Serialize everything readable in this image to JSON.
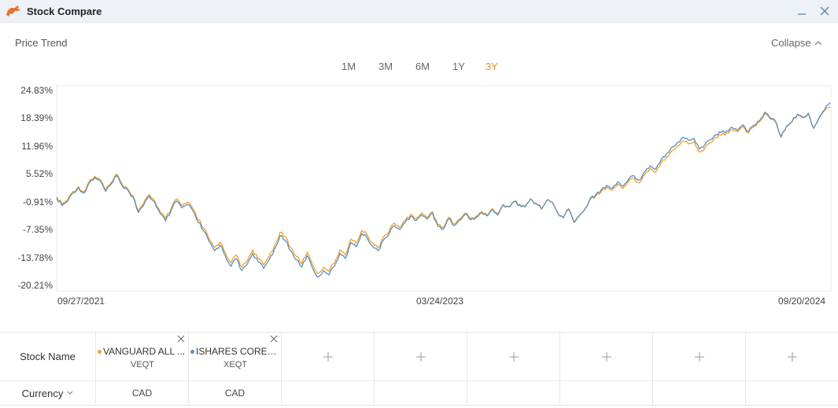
{
  "window": {
    "title": "Stock Compare",
    "brand_color": "#e8732e"
  },
  "panel": {
    "title": "Price Trend",
    "collapse_label": "Collapse"
  },
  "range_tabs": {
    "items": [
      "1M",
      "3M",
      "6M",
      "1Y",
      "3Y"
    ],
    "active": "3Y",
    "active_color": "#e8912e"
  },
  "chart_data": {
    "type": "line",
    "x_start": "09/27/2021",
    "x_end": "09/20/2024",
    "x_tick_labels": [
      "09/27/2021",
      "03/24/2023",
      "09/20/2024"
    ],
    "y_tick_labels": [
      "24.83%",
      "18.39%",
      "11.96%",
      "5.52%",
      "-0.91%",
      "-7.35%",
      "-13.78%",
      "-20.21%"
    ],
    "y_ticks": [
      24.83,
      18.39,
      11.96,
      5.52,
      -0.91,
      -7.35,
      -13.78,
      -20.21
    ],
    "ylim": [
      -20.21,
      24.83
    ],
    "grid": false,
    "series": [
      {
        "ticker": "VEQT",
        "color": "#f2a12c",
        "values": [
          0.2,
          -1.5,
          -0.5,
          1.5,
          2.6,
          1.4,
          3.8,
          5.0,
          4.2,
          1.8,
          3.5,
          5.5,
          3.2,
          2.2,
          0.5,
          -3.0,
          -1.2,
          0.8,
          -0.6,
          -3.2,
          -4.8,
          -2.5,
          -0.2,
          -1.8,
          -1.0,
          -2.5,
          -5.0,
          -7.0,
          -9.5,
          -11.5,
          -10.2,
          -12.8,
          -15.0,
          -13.2,
          -16.0,
          -14.5,
          -12.0,
          -14.0,
          -15.5,
          -13.5,
          -11.0,
          -8.0,
          -9.0,
          -11.5,
          -13.5,
          -15.2,
          -12.5,
          -15.5,
          -17.5,
          -16.0,
          -17.0,
          -15.0,
          -12.0,
          -13.2,
          -9.5,
          -10.5,
          -7.5,
          -8.5,
          -10.5,
          -11.5,
          -9.0,
          -7.8,
          -5.8,
          -6.8,
          -5.2,
          -3.8,
          -4.8,
          -3.5,
          -4.5,
          -3.2,
          -6.2,
          -6.8,
          -4.5,
          -6.0,
          -4.8,
          -3.5,
          -4.8,
          -4.2,
          -3.2,
          -4.0,
          -2.5,
          -3.8,
          -1.5,
          -2.0,
          -0.8,
          -1.5,
          -2.0,
          -0.2,
          -1.2,
          -2.5,
          -0.5,
          -1.0,
          -3.5,
          -4.5,
          -2.5,
          -5.5,
          -4.0,
          -2.5,
          -0.2,
          0.5,
          1.5,
          2.5,
          1.8,
          3.2,
          2.2,
          3.8,
          4.5,
          3.5,
          5.5,
          6.8,
          6.0,
          8.2,
          9.5,
          11.0,
          12.0,
          13.2,
          12.5,
          13.0,
          10.5,
          11.5,
          12.8,
          14.0,
          14.5,
          15.0,
          15.8,
          15.2,
          16.5,
          15.0,
          16.5,
          17.5,
          19.5,
          18.2,
          17.5,
          14.0,
          16.5,
          17.5,
          19.2,
          18.5,
          19.5,
          16.0,
          18.5,
          20.2,
          21.0
        ]
      },
      {
        "ticker": "XEQT",
        "color": "#5b8fbe",
        "values": [
          0.0,
          -1.8,
          -0.8,
          1.2,
          2.4,
          1.1,
          3.5,
          4.7,
          3.9,
          1.5,
          3.2,
          5.2,
          2.9,
          1.9,
          0.2,
          -3.4,
          -1.6,
          0.4,
          -1.0,
          -3.6,
          -5.3,
          -3.0,
          -0.7,
          -2.3,
          -1.5,
          -3.0,
          -5.6,
          -7.6,
          -10.1,
          -12.2,
          -10.9,
          -13.5,
          -15.8,
          -14.0,
          -16.8,
          -15.3,
          -12.8,
          -14.8,
          -16.3,
          -14.3,
          -11.8,
          -8.8,
          -9.8,
          -12.3,
          -14.3,
          -16.0,
          -13.3,
          -16.3,
          -18.3,
          -16.8,
          -17.8,
          -15.8,
          -12.8,
          -14.0,
          -10.3,
          -11.3,
          -8.2,
          -9.2,
          -11.2,
          -12.2,
          -9.7,
          -8.4,
          -6.4,
          -7.3,
          -5.7,
          -4.2,
          -5.2,
          -3.9,
          -4.9,
          -3.5,
          -6.6,
          -7.2,
          -4.8,
          -6.4,
          -5.1,
          -3.8,
          -5.1,
          -4.5,
          -3.4,
          -4.2,
          -2.7,
          -4.0,
          -1.6,
          -2.1,
          -0.9,
          -1.6,
          -2.1,
          -0.2,
          -1.3,
          -2.6,
          -0.5,
          -1.0,
          -3.6,
          -4.6,
          -2.6,
          -5.7,
          -4.1,
          -2.5,
          0.0,
          0.8,
          1.9,
          2.9,
          2.2,
          3.7,
          2.7,
          4.3,
          5.1,
          4.1,
          6.1,
          7.4,
          6.7,
          8.9,
          10.3,
          11.8,
          12.8,
          14.0,
          13.3,
          13.8,
          11.3,
          12.3,
          13.5,
          14.6,
          15.1,
          15.5,
          16.3,
          15.6,
          16.9,
          15.3,
          16.8,
          17.8,
          19.8,
          18.4,
          17.7,
          14.1,
          16.6,
          17.6,
          19.3,
          18.6,
          19.6,
          16.1,
          18.6,
          20.4,
          22.0
        ]
      }
    ]
  },
  "compare_table": {
    "stock_header": "Stock Name",
    "currency_header": "Currency",
    "stocks": [
      {
        "name": "VANGUARD ALL ...",
        "ticker": "VEQT",
        "currency": "CAD",
        "color": "#f2a12c"
      },
      {
        "name": "ISHARES CORE E...",
        "ticker": "XEQT",
        "currency": "CAD",
        "color": "#5b8fbe"
      }
    ],
    "empty_slots": 6
  }
}
